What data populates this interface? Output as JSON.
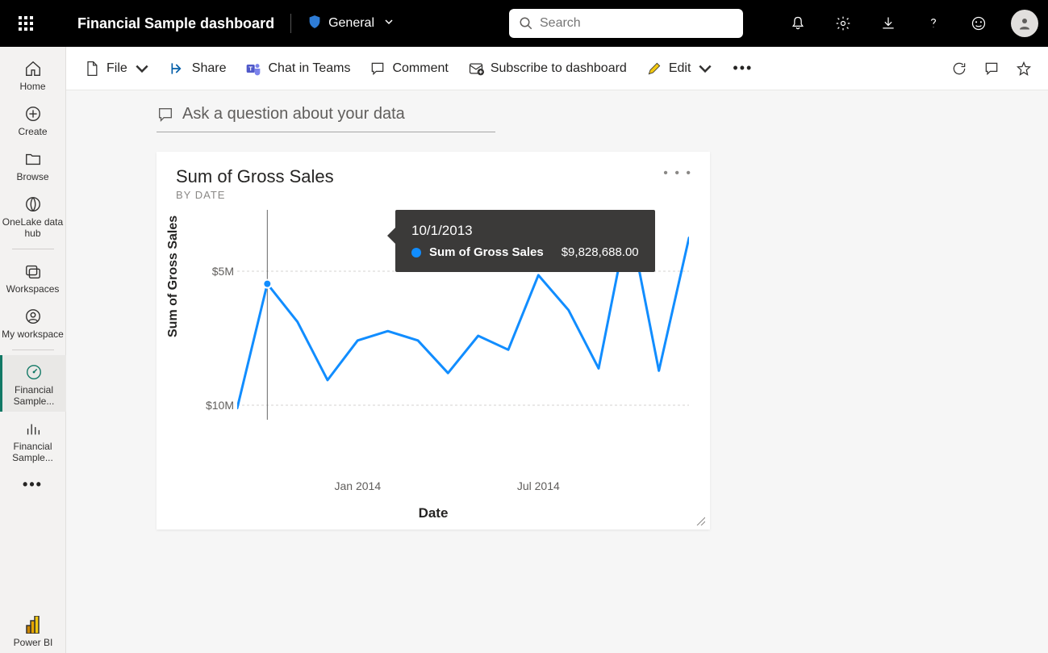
{
  "header": {
    "title": "Financial Sample  dashboard",
    "sensitivity_label": "General",
    "search_placeholder": "Search"
  },
  "leftnav": {
    "items": [
      {
        "label": "Home"
      },
      {
        "label": "Create"
      },
      {
        "label": "Browse"
      },
      {
        "label": "OneLake data hub"
      },
      {
        "label": "Workspaces"
      },
      {
        "label": "My workspace"
      },
      {
        "label": "Financial Sample..."
      },
      {
        "label": "Financial Sample..."
      }
    ],
    "brand": "Power BI"
  },
  "toolbar": {
    "file": "File",
    "share": "Share",
    "chat": "Chat in Teams",
    "comment": "Comment",
    "subscribe": "Subscribe to dashboard",
    "edit": "Edit"
  },
  "qna_placeholder": "Ask a question about your data",
  "tile": {
    "title": "Sum of Gross Sales",
    "subtitle": "BY DATE"
  },
  "tooltip": {
    "date": "10/1/2013",
    "metric_label": "Sum of Gross Sales",
    "metric_value": "$9,828,688.00"
  },
  "chart_data": {
    "type": "line",
    "title": "Sum of Gross Sales",
    "xlabel": "Date",
    "ylabel": "Sum of Gross Sales",
    "ylim": [
      4000000,
      13000000
    ],
    "yticks": [
      {
        "v": 5000000,
        "label": "$5M"
      },
      {
        "v": 10000000,
        "label": "$10M"
      }
    ],
    "xticks": [
      {
        "i": 4,
        "label": "Jan 2014"
      },
      {
        "i": 10,
        "label": "Jul 2014"
      }
    ],
    "x": [
      "2013-09",
      "2013-10",
      "2013-11",
      "2013-12",
      "2014-01",
      "2014-02",
      "2014-03",
      "2014-04",
      "2014-05",
      "2014-06",
      "2014-07",
      "2014-08",
      "2014-09",
      "2014-10",
      "2014-11",
      "2014-12"
    ],
    "values": [
      4500000,
      9828688,
      8200000,
      5700000,
      7400000,
      7800000,
      7400000,
      6000000,
      7600000,
      7000000,
      10200000,
      8700000,
      6200000,
      12700000,
      6100000,
      11800000
    ],
    "highlight_index": 1
  }
}
